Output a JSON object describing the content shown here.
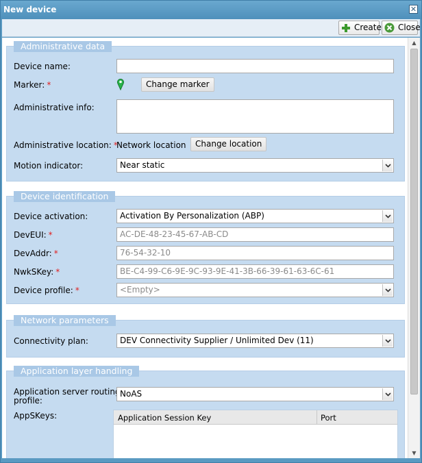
{
  "window": {
    "title": "New device",
    "close_glyph": "✕"
  },
  "toolbar": {
    "create_label": "Create",
    "close_label": "Close"
  },
  "admin": {
    "legend": "Administrative data",
    "device_name_label": "Device name:",
    "device_name_value": "",
    "marker_label": "Marker:",
    "change_marker_label": "Change marker",
    "admin_info_label": "Administrative info:",
    "admin_info_value": "",
    "admin_location_label": "Administrative location:",
    "admin_location_value": "Network location",
    "change_location_label": "Change location",
    "motion_label": "Motion indicator:",
    "motion_value": "Near static"
  },
  "identification": {
    "legend": "Device identification",
    "activation_label": "Device activation:",
    "activation_value": "Activation By Personalization (ABP)",
    "deveui_label": "DevEUI:",
    "deveui_placeholder": "AC-DE-48-23-45-67-AB-CD",
    "devaddr_label": "DevAddr:",
    "devaddr_placeholder": "76-54-32-10",
    "nwkskey_label": "NwkSKey:",
    "nwkskey_placeholder": "BE-C4-99-C6-9E-9C-93-9E-41-3B-66-39-61-63-6C-61",
    "profile_label": "Device profile:",
    "profile_value": "<Empty>"
  },
  "network": {
    "legend": "Network parameters",
    "connectivity_label": "Connectivity plan:",
    "connectivity_value": "DEV Connectivity Supplier / Unlimited Dev (11)"
  },
  "application": {
    "legend": "Application layer handling",
    "routing_label_line1": "Application server routing",
    "routing_label_line2": "profile:",
    "routing_value": "NoAS",
    "appskeys_label": "AppSKeys:",
    "grid_columns": [
      "Application Session Key",
      "Port"
    ]
  },
  "required_marker": "*",
  "colors": {
    "legend_bg": "#a9c8e6",
    "fieldset_bg": "#c5dbf0",
    "title_bg": "#5a9ac2",
    "required": "#e02020"
  }
}
